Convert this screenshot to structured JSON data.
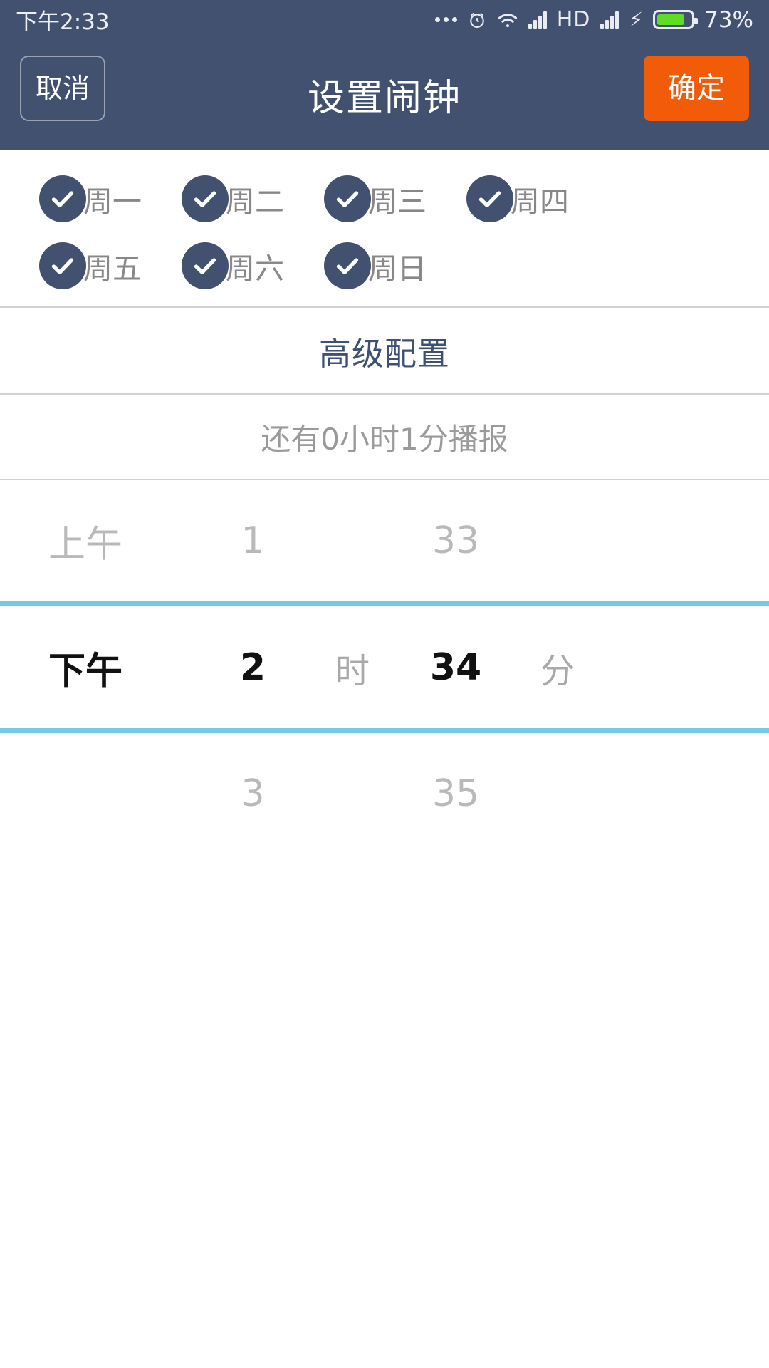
{
  "status_bar": {
    "time": "下午2:33",
    "battery_percent": "73%",
    "hd_label": "HD",
    "icons": [
      "more-dots-icon",
      "alarm-icon",
      "wifi-icon",
      "signal-icon",
      "hd-icon",
      "signal-icon-2",
      "charging-bolt-icon",
      "battery-icon"
    ]
  },
  "header": {
    "cancel_label": "取消",
    "title": "设置闹钟",
    "confirm_label": "确定",
    "bg_color": "#42516F",
    "confirm_color": "#F25B08"
  },
  "days": {
    "row1": [
      {
        "label": "周一",
        "checked": true
      },
      {
        "label": "周二",
        "checked": true
      },
      {
        "label": "周三",
        "checked": true
      },
      {
        "label": "周四",
        "checked": true
      }
    ],
    "row2": [
      {
        "label": "周五",
        "checked": true
      },
      {
        "label": "周六",
        "checked": true
      },
      {
        "label": "周日",
        "checked": true
      }
    ],
    "check_color": "#42516F"
  },
  "advanced": {
    "label": "高级配置",
    "color": "#3F5075"
  },
  "countdown": {
    "text": "还有0小时1分播报"
  },
  "time_picker": {
    "highlight_color": "#73C9E8",
    "above": {
      "ampm": "上午",
      "hour": "1",
      "hour_unit": "",
      "minute": "33",
      "minute_unit": ""
    },
    "selected": {
      "ampm": "下午",
      "hour": "2",
      "hour_unit": "时",
      "minute": "34",
      "minute_unit": "分"
    },
    "below": {
      "ampm": "",
      "hour": "3",
      "hour_unit": "",
      "minute": "35",
      "minute_unit": ""
    }
  }
}
